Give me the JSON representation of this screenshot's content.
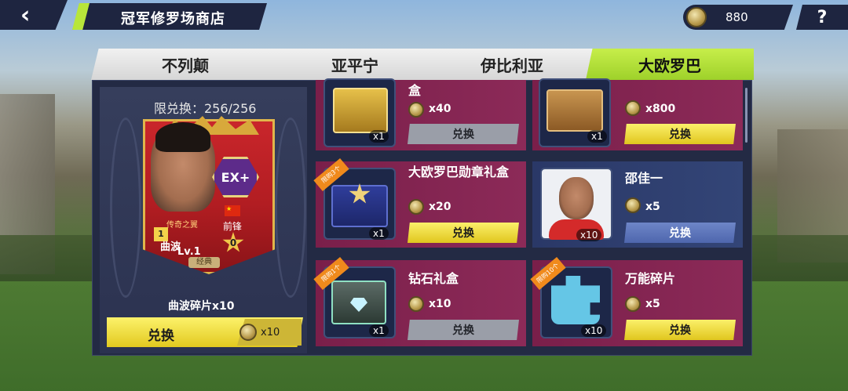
{
  "header": {
    "back_icon": "chevron-left-icon",
    "title": "冠军修罗场商店",
    "currency_icon": "coin-icon",
    "currency_amount": "880",
    "help_label": "?"
  },
  "tabs": [
    {
      "label": "不列颠",
      "active": false
    },
    {
      "label": "亚平宁",
      "active": false
    },
    {
      "label": "伊比利亚",
      "active": false
    },
    {
      "label": "大欧罗巴",
      "active": true
    }
  ],
  "featured": {
    "limit_text": "限兑换：256/256",
    "card": {
      "badge": "EX+",
      "tag": "传奇之翼",
      "number": "1",
      "name": "曲波",
      "level": "Lv.1",
      "role": "前锋",
      "stars": "0",
      "rarity": "经典",
      "flag_label": "★"
    },
    "item_label": "曲波碎片x10",
    "button_label": "兑换",
    "cost": "x10"
  },
  "items": [
    {
      "name": "盒",
      "ribbon": "",
      "qty": "x1",
      "price": "x40",
      "button": "兑换",
      "button_style": "gray"
    },
    {
      "name": "",
      "ribbon": "",
      "qty": "x1",
      "price": "x800",
      "button": "兑换",
      "button_style": "yellow"
    },
    {
      "name": "大欧罗巴勋章礼盒",
      "ribbon": "限购3个",
      "qty": "x1",
      "price": "x20",
      "button": "兑换",
      "button_style": "yellow"
    },
    {
      "name": "邵佳一",
      "ribbon": "",
      "qty": "x10",
      "price": "x5",
      "button": "兑换",
      "button_style": "blue"
    },
    {
      "name": "钻石礼盒",
      "ribbon": "限购1个",
      "qty": "x1",
      "price": "x10",
      "button": "兑换",
      "button_style": "gray"
    },
    {
      "name": "万能碎片",
      "ribbon": "限购10个",
      "qty": "x10",
      "price": "x5",
      "button": "兑换",
      "button_style": "yellow"
    }
  ]
}
